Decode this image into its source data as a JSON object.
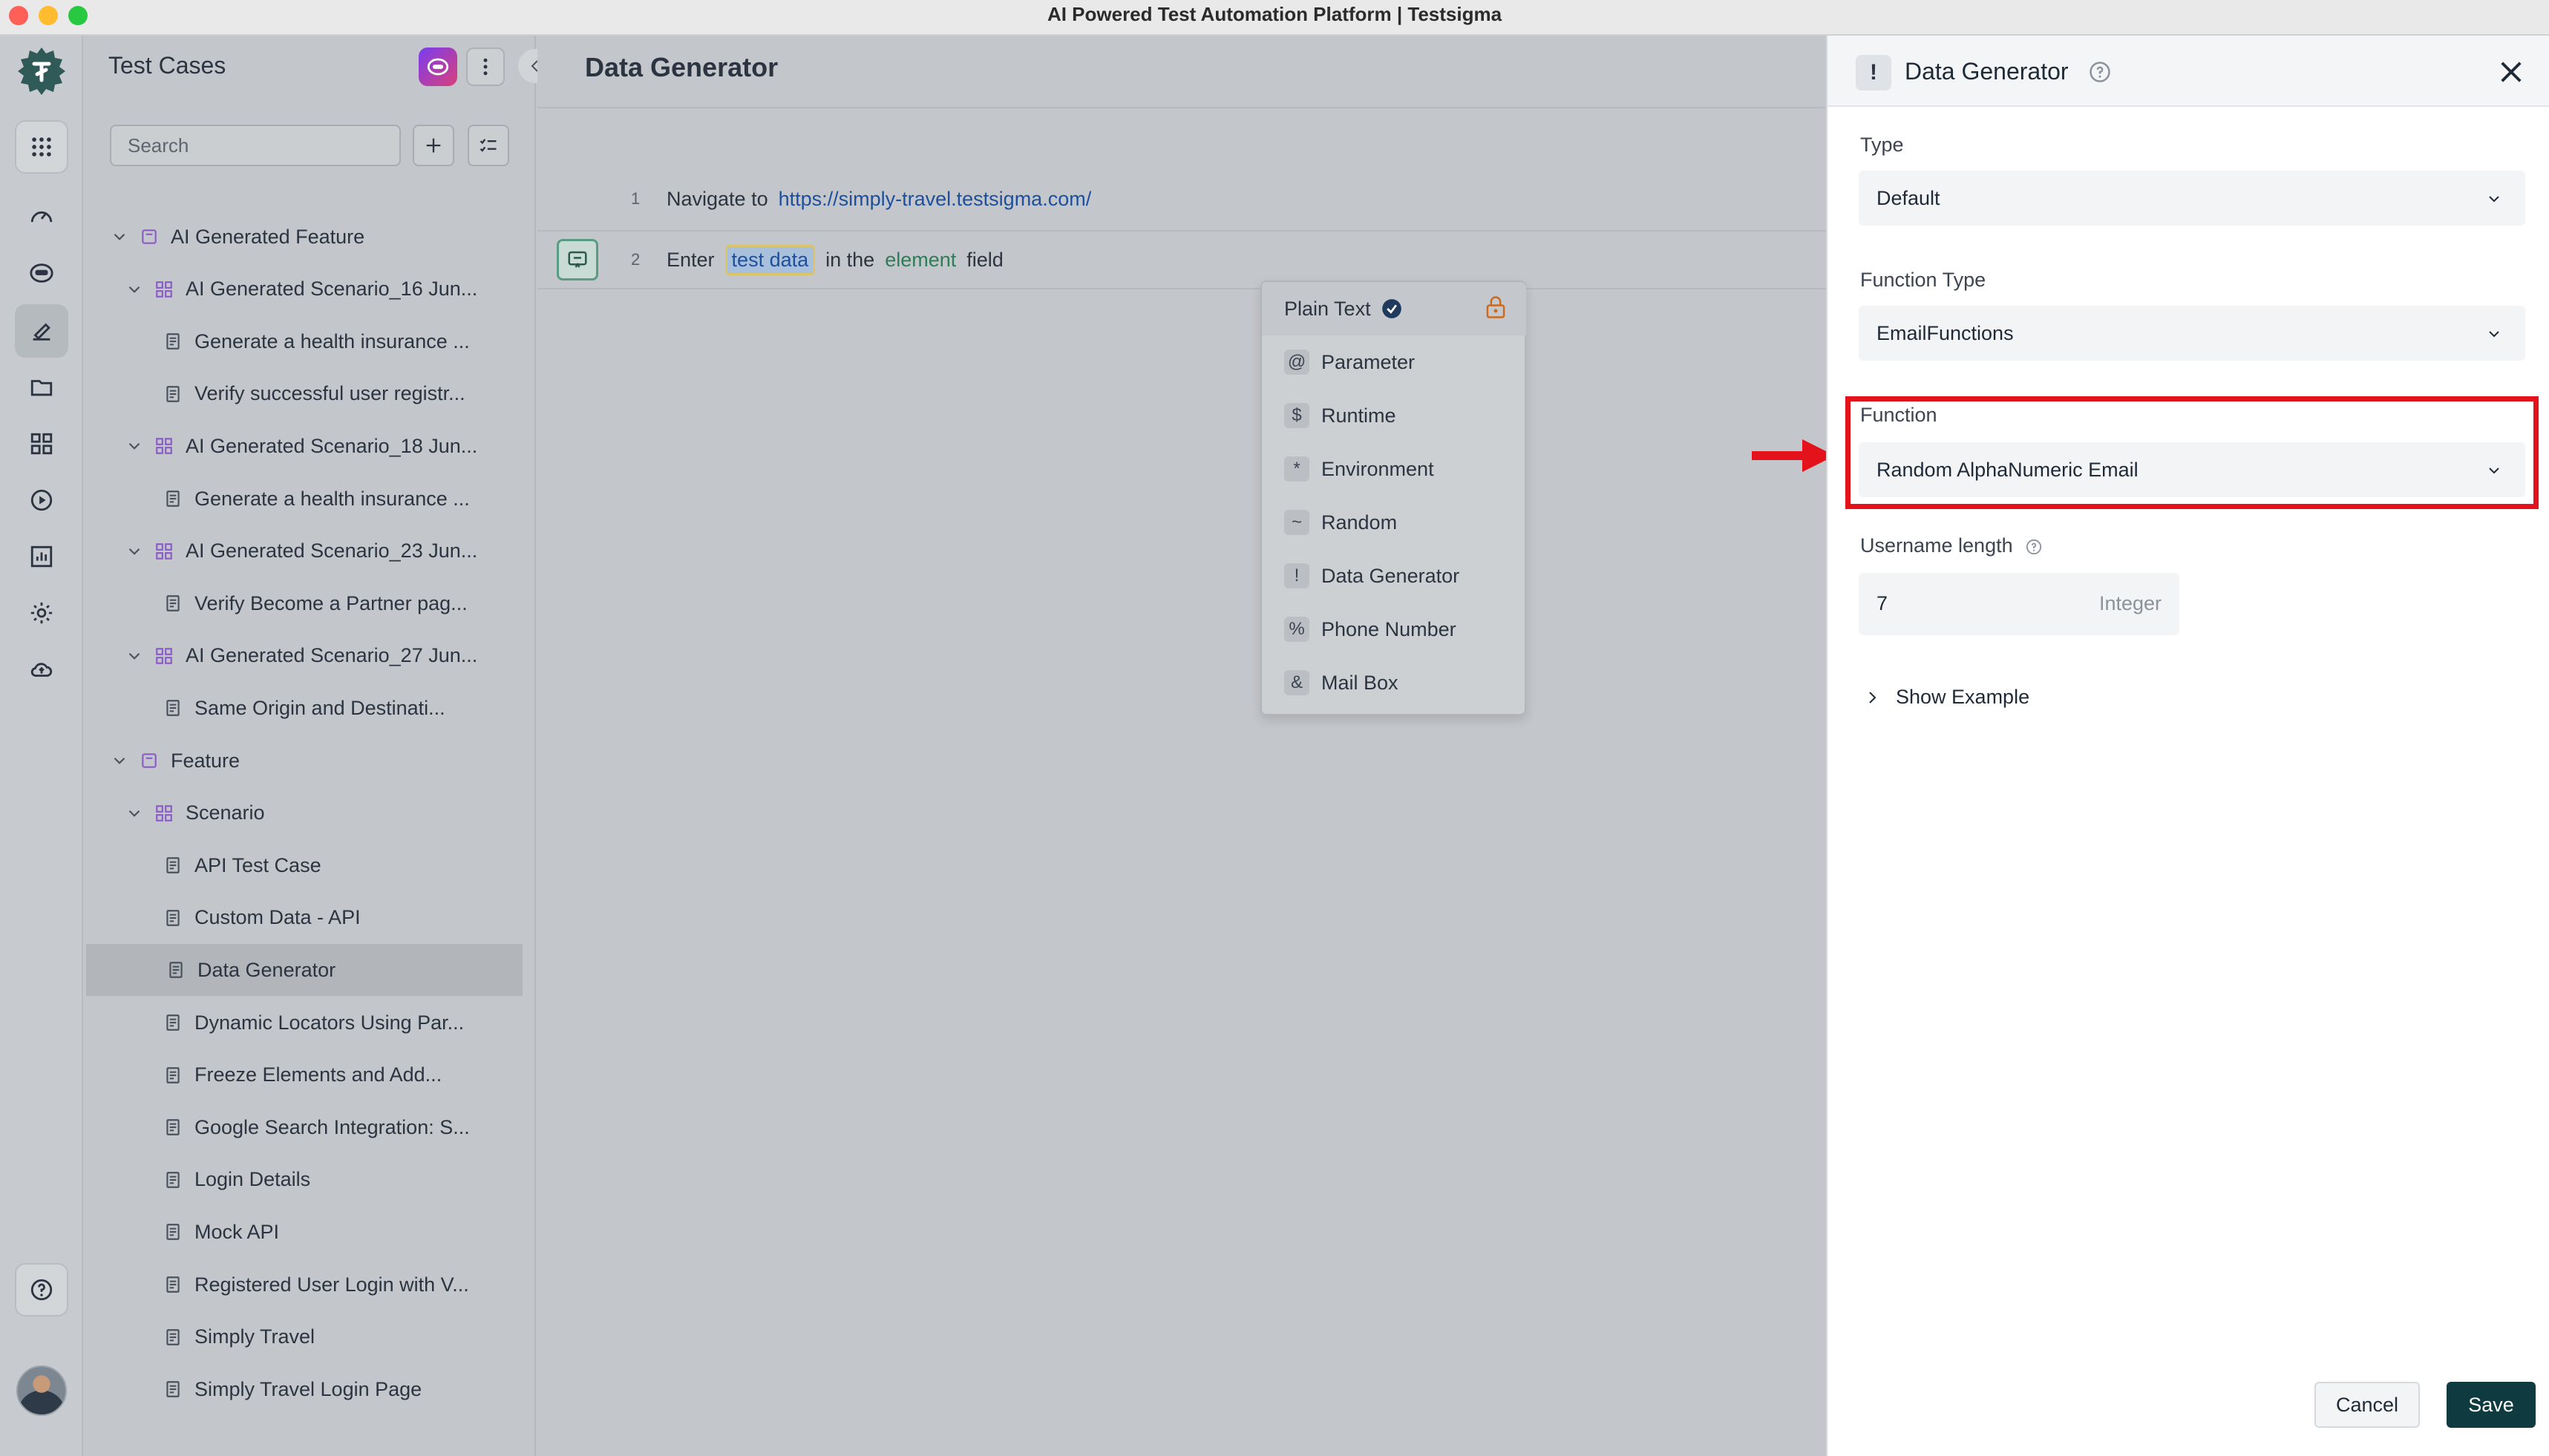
{
  "window": {
    "title": "AI Powered Test Automation Platform | Testsigma"
  },
  "sidebar": {
    "icons": [
      "apps-icon",
      "dashboard-icon",
      "agent-icon",
      "test-cases-icon",
      "folder-icon",
      "modules-icon",
      "run-icon",
      "reports-icon",
      "settings-icon",
      "cloud-icon",
      "help-icon"
    ]
  },
  "test_cases": {
    "title": "Test Cases",
    "search_placeholder": "Search",
    "tree": [
      {
        "label": "AI Generated Feature",
        "type": "feature",
        "level": 0
      },
      {
        "label": "AI Generated Scenario_16 Jun...",
        "type": "scenario",
        "level": 1
      },
      {
        "label": "Generate a health insurance ...",
        "type": "case",
        "level": 2
      },
      {
        "label": "Verify successful user registr...",
        "type": "case",
        "level": 2
      },
      {
        "label": "AI Generated Scenario_18 Jun...",
        "type": "scenario",
        "level": 1
      },
      {
        "label": "Generate a health insurance ...",
        "type": "case",
        "level": 2
      },
      {
        "label": "AI Generated Scenario_23 Jun...",
        "type": "scenario",
        "level": 1
      },
      {
        "label": "Verify Become a Partner pag...",
        "type": "case",
        "level": 2
      },
      {
        "label": "AI Generated Scenario_27 Jun...",
        "type": "scenario",
        "level": 1
      },
      {
        "label": "Same Origin and Destinati...",
        "type": "case",
        "level": 2
      },
      {
        "label": "Feature",
        "type": "feature",
        "level": 0
      },
      {
        "label": "Scenario",
        "type": "scenario",
        "level": 1
      },
      {
        "label": "API Test Case",
        "type": "case",
        "level": 2
      },
      {
        "label": "Custom Data - API",
        "type": "case",
        "level": 2
      },
      {
        "label": "Data Generator",
        "type": "case",
        "level": 2,
        "selected": true
      },
      {
        "label": "Dynamic Locators Using Par...",
        "type": "case",
        "level": 2
      },
      {
        "label": "Freeze Elements and Add...",
        "type": "case",
        "level": 2
      },
      {
        "label": "Google Search Integration: S...",
        "type": "case",
        "level": 2
      },
      {
        "label": "Login Details",
        "type": "case",
        "level": 2
      },
      {
        "label": "Mock API",
        "type": "case",
        "level": 2
      },
      {
        "label": "Registered User Login with V...",
        "type": "case",
        "level": 2
      },
      {
        "label": "Simply Travel",
        "type": "case",
        "level": 2
      },
      {
        "label": "Simply Travel Login Page",
        "type": "case",
        "level": 2
      }
    ]
  },
  "editor": {
    "title": "Data Generator",
    "steps": [
      {
        "num": "1",
        "verb": "Navigate to",
        "url": "https://simply-travel.testsigma.com/"
      },
      {
        "num": "2",
        "verb": "Enter",
        "data": "test data",
        "mid": "in the",
        "element": "element",
        "tail": "field"
      }
    ],
    "data_menu": [
      {
        "symbol": "",
        "label": "Plain Text"
      },
      {
        "symbol": "@",
        "label": "Parameter"
      },
      {
        "symbol": "$",
        "label": "Runtime"
      },
      {
        "symbol": "*",
        "label": "Environment"
      },
      {
        "symbol": "~",
        "label": "Random"
      },
      {
        "symbol": "!",
        "label": "Data Generator"
      },
      {
        "symbol": "%",
        "label": "Phone Number"
      },
      {
        "symbol": "&",
        "label": "Mail Box"
      }
    ]
  },
  "panel": {
    "icon": "!",
    "title": "Data Generator",
    "type_label": "Type",
    "type_value": "Default",
    "function_type_label": "Function Type",
    "function_type_value": "EmailFunctions",
    "function_label": "Function",
    "function_value": "Random AlphaNumeric Email",
    "username_label": "Username length",
    "username_value": "7",
    "username_unit": "Integer",
    "show_example": "Show Example",
    "cancel": "Cancel",
    "save": "Save",
    "highlight_color": "#e3121b"
  }
}
